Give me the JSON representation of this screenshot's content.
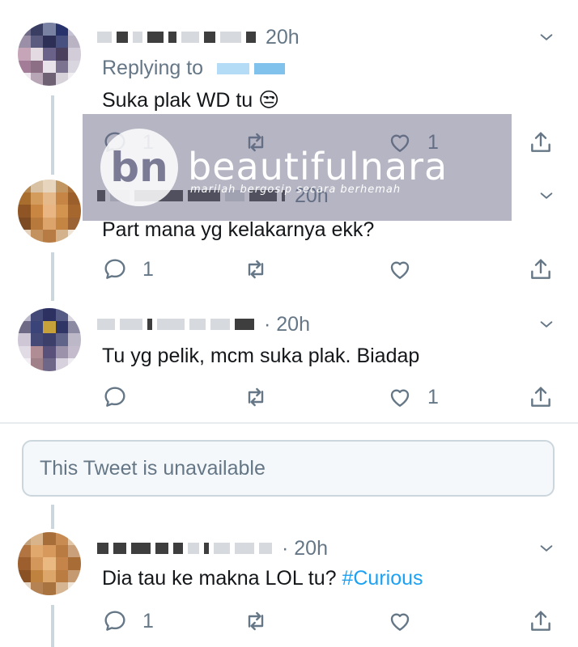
{
  "tweets": [
    {
      "time": "20h",
      "reply_label": "Replying to",
      "text": "Suka plak WD tu",
      "emoji": "😒",
      "reply_count": "1",
      "like_count": "1"
    },
    {
      "time": "20h",
      "text": "Part mana yg kelakarnya ekk?",
      "reply_count": "1"
    },
    {
      "time": "· 20h",
      "text": "Tu yg pelik, mcm suka plak. Biadap",
      "like_count": "1"
    },
    {
      "time": "· 20h",
      "text": "Dia tau ke makna LOL tu?",
      "hashtag": "#Curious",
      "reply_count": "1"
    }
  ],
  "unavailable_text": "This Tweet is unavailable",
  "watermark": {
    "logo": "bn",
    "brand": "beautifulnara",
    "tagline": "marilah bergosip secara berhemah"
  },
  "colors": {
    "secondary_text": "#657786",
    "hashtag": "#1da1f2",
    "thread_line": "#ccd6dd"
  },
  "icons": [
    "reply-icon",
    "retweet-icon",
    "like-icon",
    "share-icon",
    "chevron-down-icon"
  ]
}
